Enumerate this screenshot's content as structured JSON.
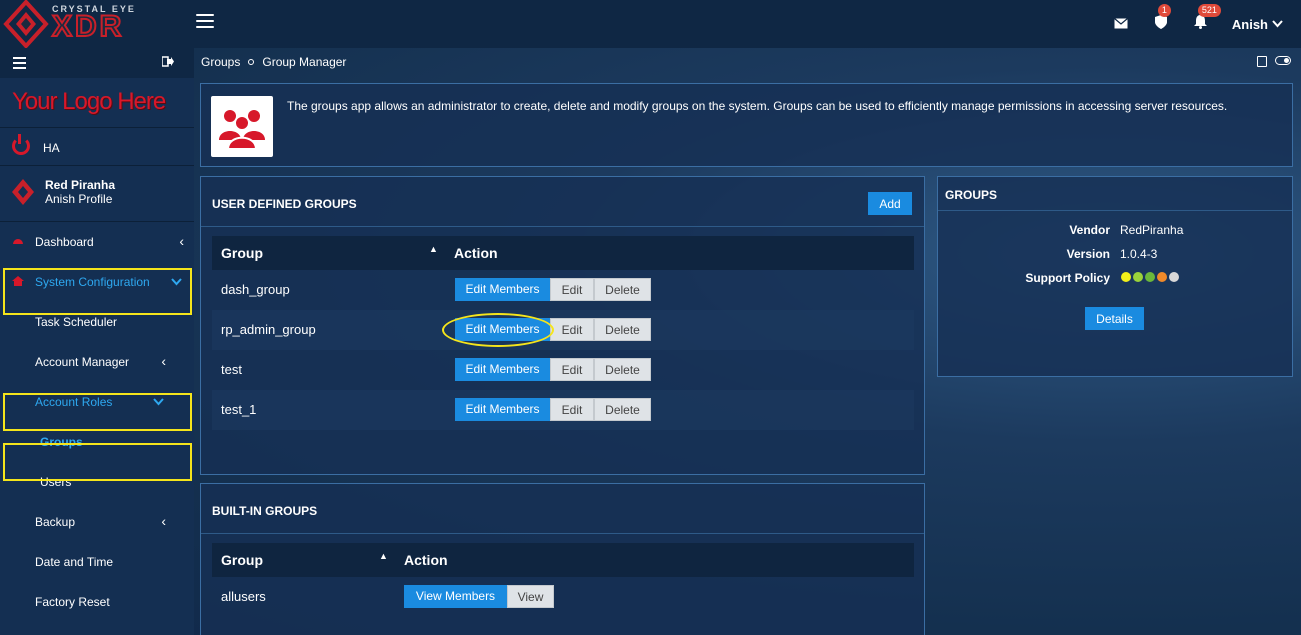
{
  "brand": {
    "top": "CRYSTAL EYE",
    "main": "XDR"
  },
  "topbar": {
    "badges": {
      "shield": "1",
      "bell": "521"
    },
    "user": "Anish"
  },
  "sidebar": {
    "logo_text": "Your Logo Here",
    "ha_label": "HA",
    "profile": {
      "name": "Red Piranha",
      "sub": "Anish Profile"
    },
    "items": [
      {
        "label": "Dashboard"
      },
      {
        "label": "System Configuration"
      },
      {
        "label": "Task Scheduler"
      },
      {
        "label": "Account Manager"
      },
      {
        "label": "Account Roles"
      },
      {
        "label": "Groups"
      },
      {
        "label": "Users"
      },
      {
        "label": "Backup"
      },
      {
        "label": "Date and Time"
      },
      {
        "label": "Factory Reset"
      }
    ]
  },
  "breadcrumb": {
    "first": "Groups",
    "second": "Group Manager"
  },
  "info_text": "The groups app allows an administrator to create, delete and modify groups on the system. Groups can be used to efficiently manage permissions in accessing server resources.",
  "user_groups": {
    "title": "USER DEFINED GROUPS",
    "add_label": "Add",
    "headers": {
      "group": "Group",
      "action": "Action"
    },
    "rows": [
      {
        "name": "dash_group"
      },
      {
        "name": "rp_admin_group"
      },
      {
        "name": "test"
      },
      {
        "name": "test_1"
      }
    ],
    "edit_members_label": "Edit Members",
    "edit_label": "Edit",
    "delete_label": "Delete"
  },
  "builtin_groups": {
    "title": "BUILT-IN GROUPS",
    "headers": {
      "group": "Group",
      "action": "Action"
    },
    "rows": [
      {
        "name": "allusers"
      }
    ],
    "view_members_label": "View Members",
    "view_label": "View"
  },
  "groups_card": {
    "title": "GROUPS",
    "vendor_key": "Vendor",
    "vendor_val": "RedPiranha",
    "version_key": "Version",
    "version_val": "1.0.4-3",
    "support_key": "Support Policy",
    "support_colors": [
      "#f2ef1a",
      "#9bd23a",
      "#6cb83a",
      "#f08a2a",
      "#d8d8d8"
    ],
    "details_label": "Details"
  },
  "colors": {
    "accent": "#1a8be0",
    "brand_red": "#d7182a",
    "highlight": "#f5e51b"
  }
}
